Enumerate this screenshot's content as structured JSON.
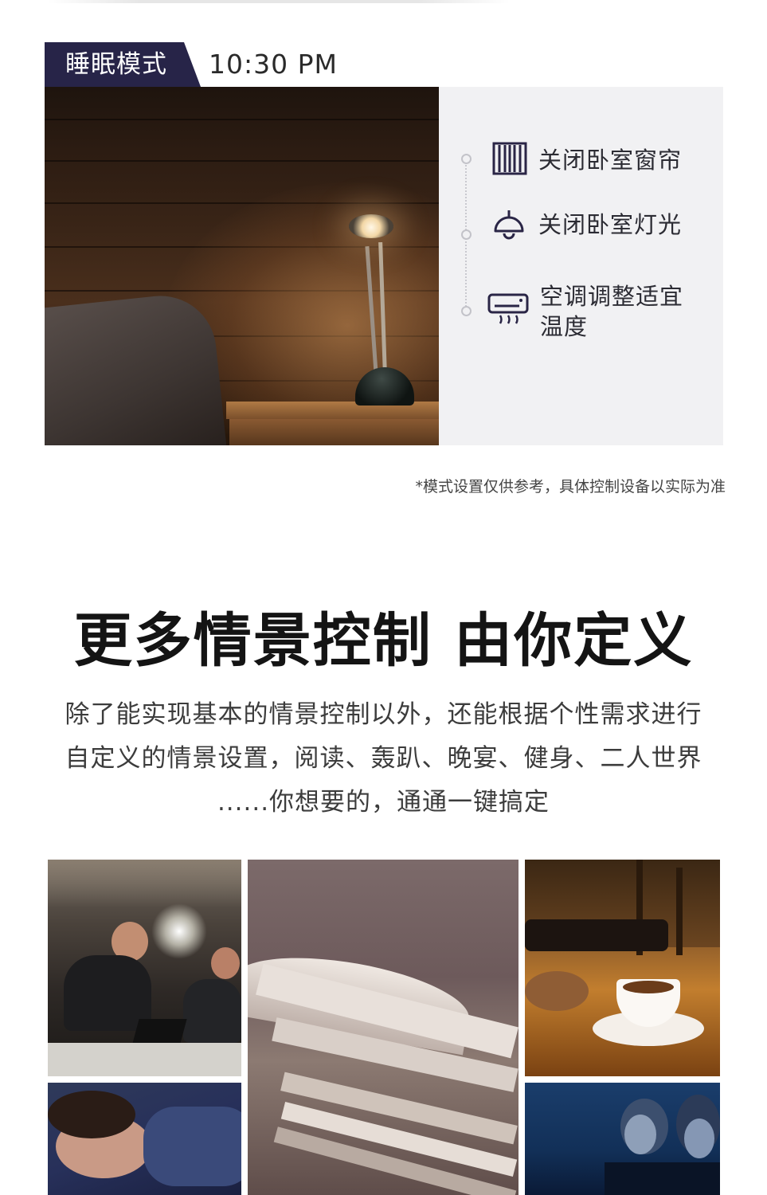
{
  "mode": {
    "name": "睡眠模式",
    "time": "10:30 PM"
  },
  "steps": [
    {
      "icon": "curtain-icon",
      "label": "关闭卧室窗帘"
    },
    {
      "icon": "ceiling-lamp-icon",
      "label": "关闭卧室灯光"
    },
    {
      "icon": "air-conditioner-icon",
      "label_line1": "空调调整适宜",
      "label_line2": "温度"
    }
  ],
  "note": "*模式设置仅供参考，具体控制设备以实际为准",
  "section": {
    "headline": "更多情景控制 由你定义",
    "paragraph_lines": [
      "除了能实现基本的情景控制以外，还能根据个性需求进行",
      "自定义的情景设置，阅读、轰趴、晚宴、健身、二人世界",
      "......你想要的，通通一键搞定"
    ]
  },
  "colors": {
    "mode_tag_bg": "#272448",
    "panel_bg": "#f1f1f3",
    "icon_stroke": "#2a2546"
  }
}
